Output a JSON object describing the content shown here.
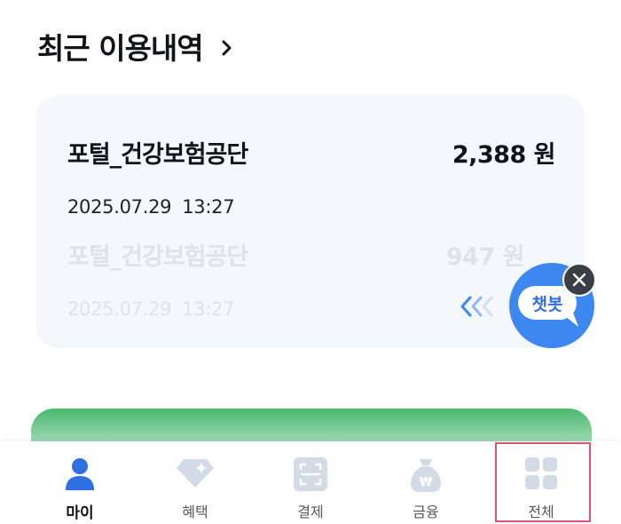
{
  "section": {
    "title": "최근 이용내역"
  },
  "transactions": [
    {
      "name": "포털_건강보험공단",
      "amount": "2,388 원",
      "date": "2025.07.29",
      "time": "13:27"
    },
    {
      "name": "포털_건강보험공단",
      "amount": "947 원",
      "date": "2025.07.29",
      "time": "13:27"
    }
  ],
  "chatbot": {
    "label": "챗봇"
  },
  "tabs": [
    {
      "label": "마이",
      "icon": "person-icon",
      "active": true
    },
    {
      "label": "혜택",
      "icon": "diamond-icon",
      "active": false
    },
    {
      "label": "결제",
      "icon": "scan-icon",
      "active": false
    },
    {
      "label": "금융",
      "icon": "money-bag-icon",
      "active": false
    },
    {
      "label": "전체",
      "icon": "grid-icon",
      "active": false
    }
  ],
  "colors": {
    "accent": "#3d87f0",
    "promo": "#1da64a",
    "highlight": "#d9557a",
    "tab_icon": "#d3dbe7",
    "active_icon": "#2f6fe3"
  }
}
